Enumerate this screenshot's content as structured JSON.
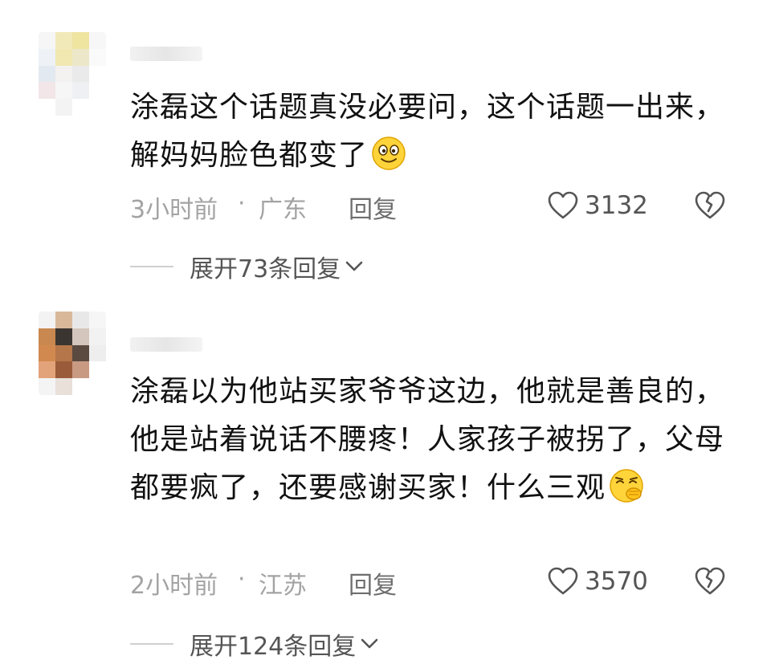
{
  "comments": [
    {
      "content": "涂磊这个话题真没必要问，这个话题一出来，解妈妈脸色都变了",
      "emoji": "smiling-face-emoji",
      "time": "3小时前",
      "separator": "·",
      "location": "广东",
      "reply_label": "回复",
      "likes": "3132",
      "expand_label": "展开73条回复"
    },
    {
      "content": "涂磊以为他站买家爷爷这边，他就是善良的，他是站着说话不腰疼！人家孩子被拐了，父母都要疯了，还要感谢买家！什么三观",
      "emoji": "covering-mouth-emoji",
      "time": "2小时前",
      "separator": "·",
      "location": "江苏",
      "reply_label": "回复",
      "likes": "3570",
      "expand_label": "展开124条回复"
    }
  ],
  "colors": {
    "text": "#111111",
    "meta": "#a3a3a3",
    "reply": "#6e6e6e",
    "count": "#555555",
    "divider": "#d0d0d0",
    "emoji_yellow": "#ffd43b"
  }
}
